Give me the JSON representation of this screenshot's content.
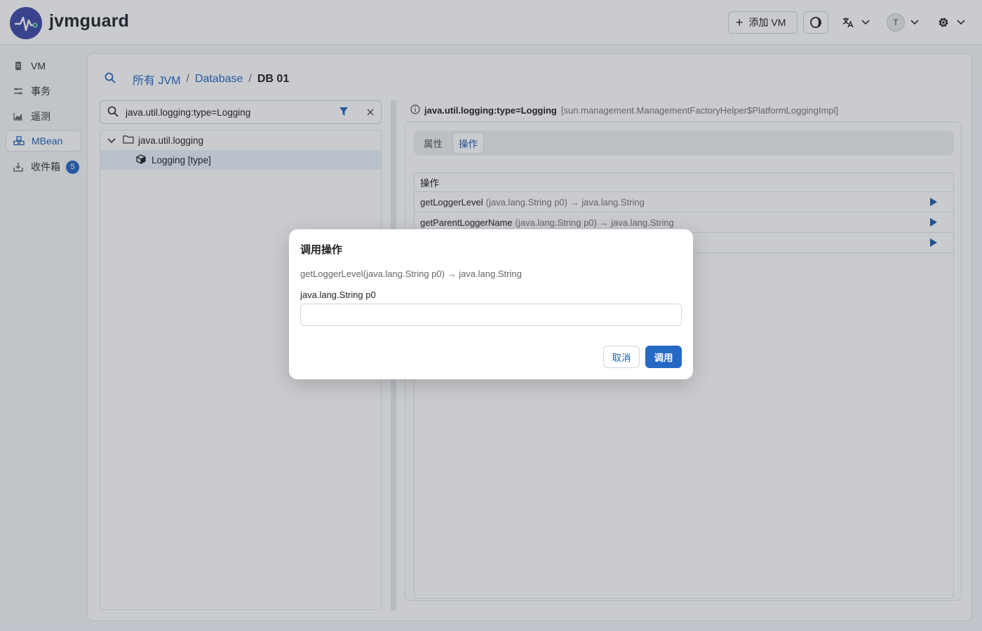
{
  "header": {
    "app_name": "jvmguard",
    "add_vm_label": "添加 VM",
    "user_initial": "T"
  },
  "sidebar": {
    "items": [
      {
        "label": "VM",
        "icon": "server-icon"
      },
      {
        "label": "事务",
        "icon": "transactions-icon"
      },
      {
        "label": "遥测",
        "icon": "chart-icon"
      },
      {
        "label": "MBean",
        "icon": "cubes-icon",
        "active": true
      },
      {
        "label": "收件箱",
        "icon": "inbox-icon",
        "badge": "5"
      }
    ]
  },
  "breadcrumb": {
    "items": [
      "所有 JVM",
      "Database"
    ],
    "current": "DB 01",
    "separator": "/"
  },
  "search": {
    "value": "java.util.logging:type=Logging"
  },
  "tree": {
    "folder": "java.util.logging",
    "leaf": "Logging [type]"
  },
  "detail": {
    "object_name": "java.util.logging:type=Logging",
    "class_name": "[sun.management.ManagementFactoryHelper$PlatformLoggingImpl]",
    "tabs": [
      "属性",
      "操作"
    ],
    "active_tab": "操作",
    "ops_header": "操作",
    "operations": [
      {
        "name": "getLoggerLevel",
        "signature": "(java.lang.String p0) → java.lang.String"
      },
      {
        "name": "getParentLoggerName",
        "signature": "(java.lang.String p0) → java.lang.String"
      },
      {
        "name": "",
        "signature": ""
      }
    ]
  },
  "dialog": {
    "title": "调用操作",
    "signature": "getLoggerLevel(java.lang.String p0) → java.lang.String",
    "param_label": "java.lang.String p0",
    "param_value": "",
    "cancel_label": "取消",
    "invoke_label": "调用"
  },
  "colors": {
    "accent": "#2569c4",
    "logo_bg": "#3f4aa8"
  }
}
